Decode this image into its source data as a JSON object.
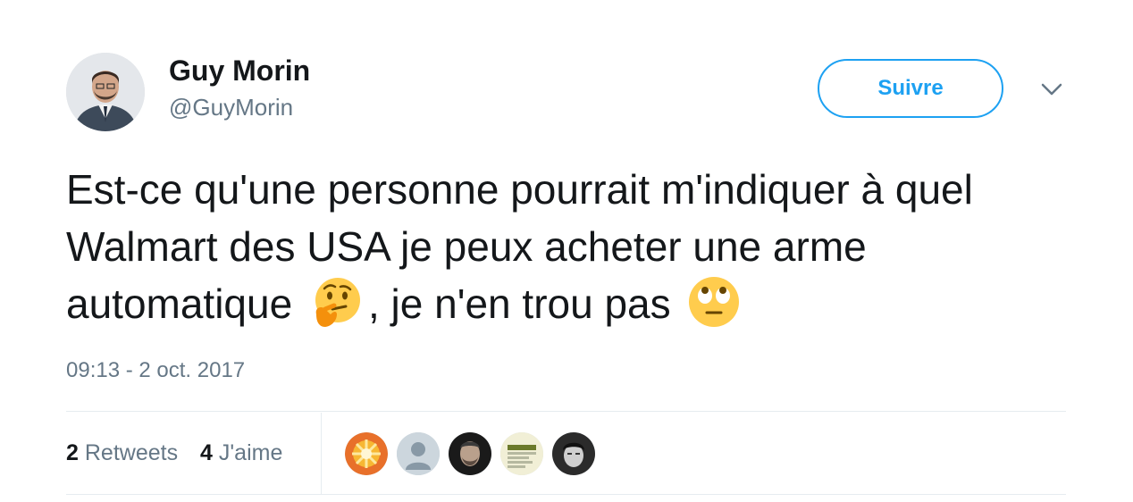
{
  "tweet": {
    "author": {
      "name": "Guy Morin",
      "handle": "@GuyMorin"
    },
    "follow_label": "Suivre",
    "text": {
      "part1": "Est-ce qu'une personne pourrait m'indiquer à quel Walmart des USA je peux acheter une arme automatique",
      "part2": ", je n'en trou pas"
    },
    "timestamp": "09:13 - 2 oct. 2017",
    "stats": {
      "retweets_count": "2",
      "retweets_label": "Retweets",
      "likes_count": "4",
      "likes_label": "J'aime"
    },
    "likers_count": 5
  },
  "colors": {
    "accent": "#1da1f2",
    "secondary_text": "#657786",
    "primary_text": "#14171a",
    "divider": "#e6ecf0"
  },
  "icons": {
    "emoji_1": "thinking-face-icon",
    "emoji_2": "face-with-rolling-eyes-icon",
    "menu": "chevron-down-icon"
  }
}
